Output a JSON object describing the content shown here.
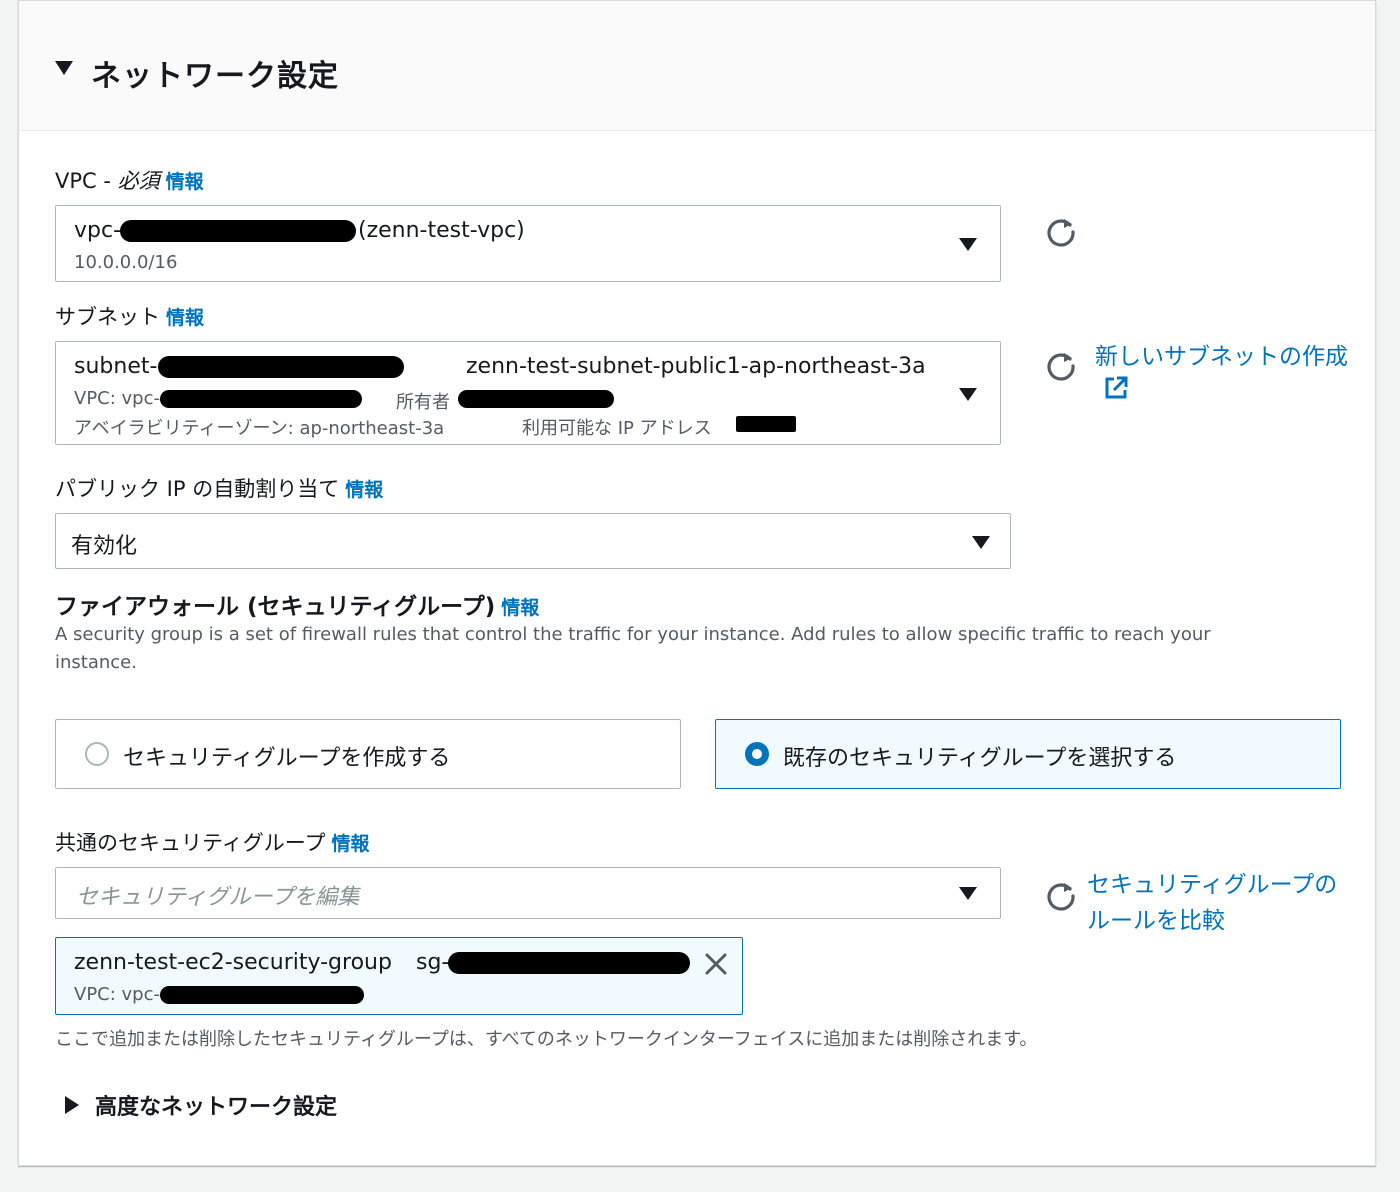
{
  "section": {
    "title": "ネットワーク設定",
    "info_label": "情報"
  },
  "vpc": {
    "label": "VPC - ",
    "required": "必須",
    "value_prefix": "vpc-",
    "value_name": "(zenn-test-vpc)",
    "cidr": "10.0.0.0/16"
  },
  "subnet": {
    "label": "サブネット",
    "value_prefix": "subnet-",
    "value_name": "zenn-test-subnet-public1-ap-northeast-3a",
    "vpc_prefix": "VPC: vpc-",
    "owner_label": "所有者",
    "az": "アベイラビリティーゾーン: ap-northeast-3a",
    "ip_label": "利用可能な IP アドレス",
    "create_link": "新しいサブネットの作成"
  },
  "public_ip": {
    "label": "パブリック IP の自動割り当て",
    "value": "有効化"
  },
  "firewall": {
    "title": "ファイアウォール (セキュリティグループ)",
    "description": "A security group is a set of firewall rules that control the traffic for your instance. Add rules to allow specific traffic to reach your instance.",
    "option_create": "セキュリティグループを作成する",
    "option_existing": "既存のセキュリティグループを選択する",
    "selected_option": "existing"
  },
  "common_sg": {
    "label": "共通のセキュリティグループ",
    "placeholder": "セキュリティグループを編集",
    "compare_link": "セキュリティグループのルールを比較",
    "token_name": "zenn-test-ec2-security-group",
    "token_sg_prefix": "sg-",
    "token_vpc_prefix": "VPC: vpc-",
    "note": "ここで追加または削除したセキュリティグループは、すべてのネットワークインターフェイスに追加または削除されます。"
  },
  "advanced": {
    "label": "高度なネットワーク設定"
  },
  "icons": {
    "refresh": "refresh-icon",
    "external": "external-link-icon",
    "close": "close-icon"
  },
  "colors": {
    "link": "#0073bb",
    "selected_bg": "#f1faff",
    "border": "#aab7b8"
  }
}
